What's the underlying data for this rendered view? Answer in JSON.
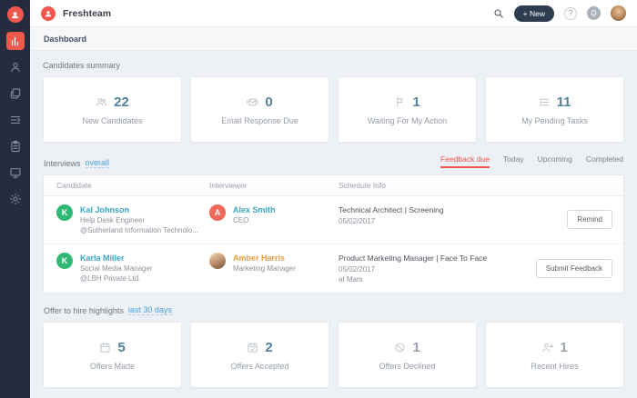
{
  "colors": {
    "brand": "#F2574D",
    "scope_link_blue": "#4AA0DC",
    "name_link_teal": "#38A6C0",
    "name_amber": "#E99C3F",
    "card_value": "#54819B",
    "avatar_green": "#2EB873",
    "avatar_red": "#F0695A",
    "sidebar_bg": "#262B3F",
    "active_tab": "#F2574D"
  },
  "topbar": {
    "brand": "Freshteam",
    "new_button": "+ New",
    "help_label": "?"
  },
  "breadcrumb": "Dashboard",
  "sidebar": {
    "items": [
      {
        "name": "dashboard",
        "icon": "dashboard-icon",
        "active": true
      },
      {
        "name": "candidates",
        "icon": "person-icon",
        "active": false
      },
      {
        "name": "job-postings",
        "icon": "layers-icon",
        "active": false
      },
      {
        "name": "referrals",
        "icon": "list-arrow-icon",
        "active": false
      },
      {
        "name": "onboarding",
        "icon": "clipboard-icon",
        "active": false
      },
      {
        "name": "reports",
        "icon": "monitor-icon",
        "active": false
      },
      {
        "name": "settings",
        "icon": "gear-icon",
        "active": false
      }
    ]
  },
  "candidates_summary": {
    "title": "Candidates summary",
    "cards": [
      {
        "icon": "people-icon",
        "value": "22",
        "label": "New Candidates"
      },
      {
        "icon": "email-icon",
        "value": "0",
        "label": "Email Response Due"
      },
      {
        "icon": "flag-icon",
        "value": "1",
        "label": "Waiting For My Action"
      },
      {
        "icon": "tasks-icon",
        "value": "11",
        "label": "My Pending Tasks"
      }
    ]
  },
  "interviews": {
    "title": "Interviews",
    "scope_link": "overall",
    "tabs": [
      "Feedback due",
      "Today",
      "Upcoming",
      "Completed"
    ],
    "active_tab": "Feedback due",
    "columns": [
      "Candidate",
      "Interviewer",
      "Schedule Info"
    ],
    "rows": [
      {
        "candidate": {
          "initial": "K",
          "name": "Kal Johnson",
          "role": "Help Desk Engineer",
          "company": "@Sutherland Information Technolo..."
        },
        "interviewer": {
          "initial": "A",
          "name": "Alex Smith",
          "role": "CEO"
        },
        "schedule": {
          "line1": "Technical Architect | Screening",
          "line2": "05/02/2017",
          "line3": ""
        },
        "action": "Remind"
      },
      {
        "candidate": {
          "initial": "K",
          "name": "Karla Miller",
          "role": "Social Media Manager",
          "company": "@LBH Private Ltd."
        },
        "interviewer": {
          "initial": "",
          "name": "Amber Harris",
          "role": "Marketing Manager"
        },
        "schedule": {
          "line1": "Product Marketing Manager | Face To Face",
          "line2": "05/02/2017",
          "line3": "at Mars"
        },
        "action": "Submit Feedback"
      }
    ]
  },
  "offers": {
    "title": "Offer to hire highlights",
    "scope_link": "last 30 days",
    "cards": [
      {
        "icon": "calendar-icon",
        "value": "5",
        "label": "Offers Made",
        "muted": false
      },
      {
        "icon": "calendar-check-icon",
        "value": "2",
        "label": "Offers Accepted",
        "muted": false
      },
      {
        "icon": "declined-icon",
        "value": "1",
        "label": "Offers Declined",
        "muted": true
      },
      {
        "icon": "hire-icon",
        "value": "1",
        "label": "Recent Hires",
        "muted": true
      }
    ]
  }
}
